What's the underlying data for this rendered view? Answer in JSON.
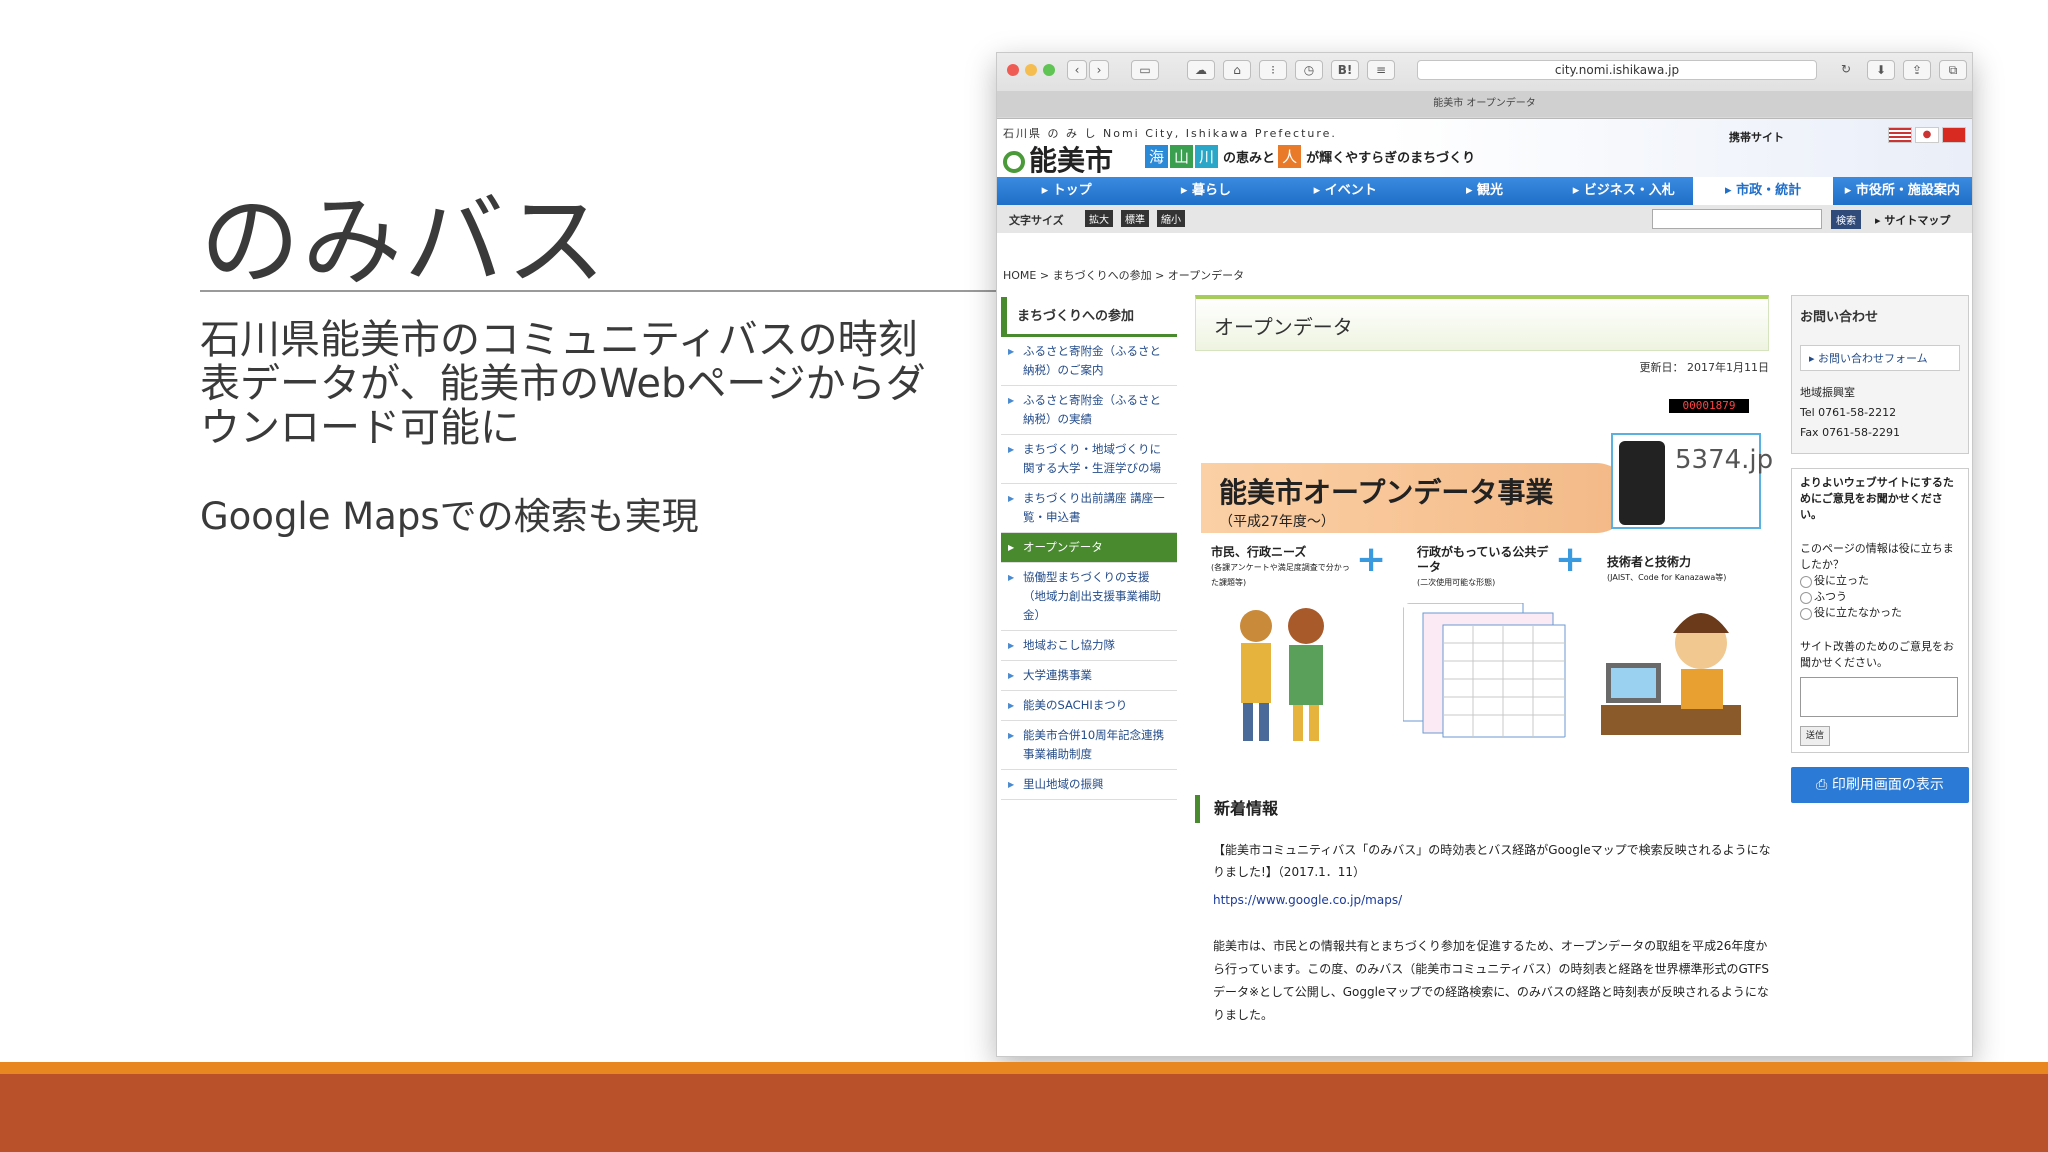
{
  "slide": {
    "title": "のみバス",
    "body_line1": "石川県能美市のコミュニティバスの時刻",
    "body_line2": "表データが、能美市のWebページからダ",
    "body_line3": "ウンロード可能に",
    "body2": "Google Mapsでの検索も実現"
  },
  "browser": {
    "url": "city.nomi.ishikawa.jp",
    "tab_title": "能美市 オープンデータ",
    "toolbar_bookmark": "B!"
  },
  "site": {
    "sub": "石川県 の み し Nomi City, Ishikawa Prefecture.",
    "logo": "能美市",
    "badges": [
      "海",
      "山",
      "川"
    ],
    "slogan1": "の恵みと",
    "badge_person": "人",
    "slogan2": "が輝くやすらぎのまちづくり",
    "mobile": "携帯サイト",
    "nav": [
      "▸ トップ",
      "▸ 暮らし",
      "▸ イベント",
      "▸ 観光",
      "▸ ビジネス・入札",
      "▸ 市政・統計",
      "▸ 市役所・施設案内"
    ],
    "font_size_label": "文字サイズ",
    "font_sizes": [
      "拡大",
      "標準",
      "縮小"
    ],
    "search_btn": "検索",
    "sitemap": "▸ サイトマップ",
    "breadcrumb": "HOME > まちづくりへの参加 > オープンデータ"
  },
  "leftnav": {
    "head": "まちづくりへの参加",
    "items": [
      "ふるさと寄附金（ふるさと納税）のご案内",
      "ふるさと寄附金（ふるさと納税）の実績",
      "まちづくり・地域づくりに関する大学・生涯学びの場",
      "まちづくり出前講座 講座一覧・申込書",
      "オープンデータ",
      "協働型まちづくりの支援（地域力創出支援事業補助金）",
      "地域おこし協力隊",
      "大学連携事業",
      "能美のSACHIまつり",
      "能美市合併10周年記念連携事業補助制度",
      "里山地域の振興"
    ]
  },
  "main": {
    "heading": "オープンデータ",
    "updated": "更新日： 2017年1月11日",
    "counter": "00001879",
    "banner_title": "能美市オープンデータ事業",
    "banner_sub": "（平成27年度～）",
    "phone_num": "5374.jp",
    "cap1": "市民、行政ニーズ",
    "cap1_sub": "(各課アンケートや満足度調査で分かった課題等)",
    "cap2": "行政がもっている公共データ",
    "cap2_sub": "(二次使用可能な形態)",
    "cap3": "技術者と技術力",
    "cap3_sub": "(JAIST、Code for Kanazawa等)",
    "news_head": "新着情報",
    "news_text": "【能美市コミュニティバス「のみバス」の時効表とバス経路がGoogleマップで検索反映されるようになりました!】（2017.1．11）",
    "news_link": "https://www.google.co.jp/maps/",
    "news_body": "能美市は、市民との情報共有とまちづくり参加を促進するため、オープンデータの取組を平成26年度から行っています。この度、のみバス（能美市コミュニティバス）の時刻表と経路を世界標準形式のGTFSデータ※として公開し、Goggleマップでの経路検索に、のみバスの経路と時刻表が反映されるようになりました。"
  },
  "rightside": {
    "contact_head": "お問い合わせ",
    "contact_form": "▸ お問い合わせフォーム",
    "dept": "地域振興室",
    "tel": "Tel 0761-58-2212",
    "fax": "Fax 0761-58-2291",
    "survey_intro": "よりよいウェブサイトにするためにご意見をお聞かせください。",
    "survey_q": "このページの情報は役に立ちましたか？",
    "options": [
      "役に立った",
      "ふつう",
      "役に立たなかった"
    ],
    "survey_q2": "サイト改善のためのご意見をお聞かせください。",
    "send": "送信",
    "print": "印刷用画面の表示"
  },
  "colors": {
    "accent_orange": "#e8861f",
    "footer_brown": "#b9522a",
    "nav_blue": "#1f6ec8",
    "nav_green": "#4a8a2e"
  }
}
